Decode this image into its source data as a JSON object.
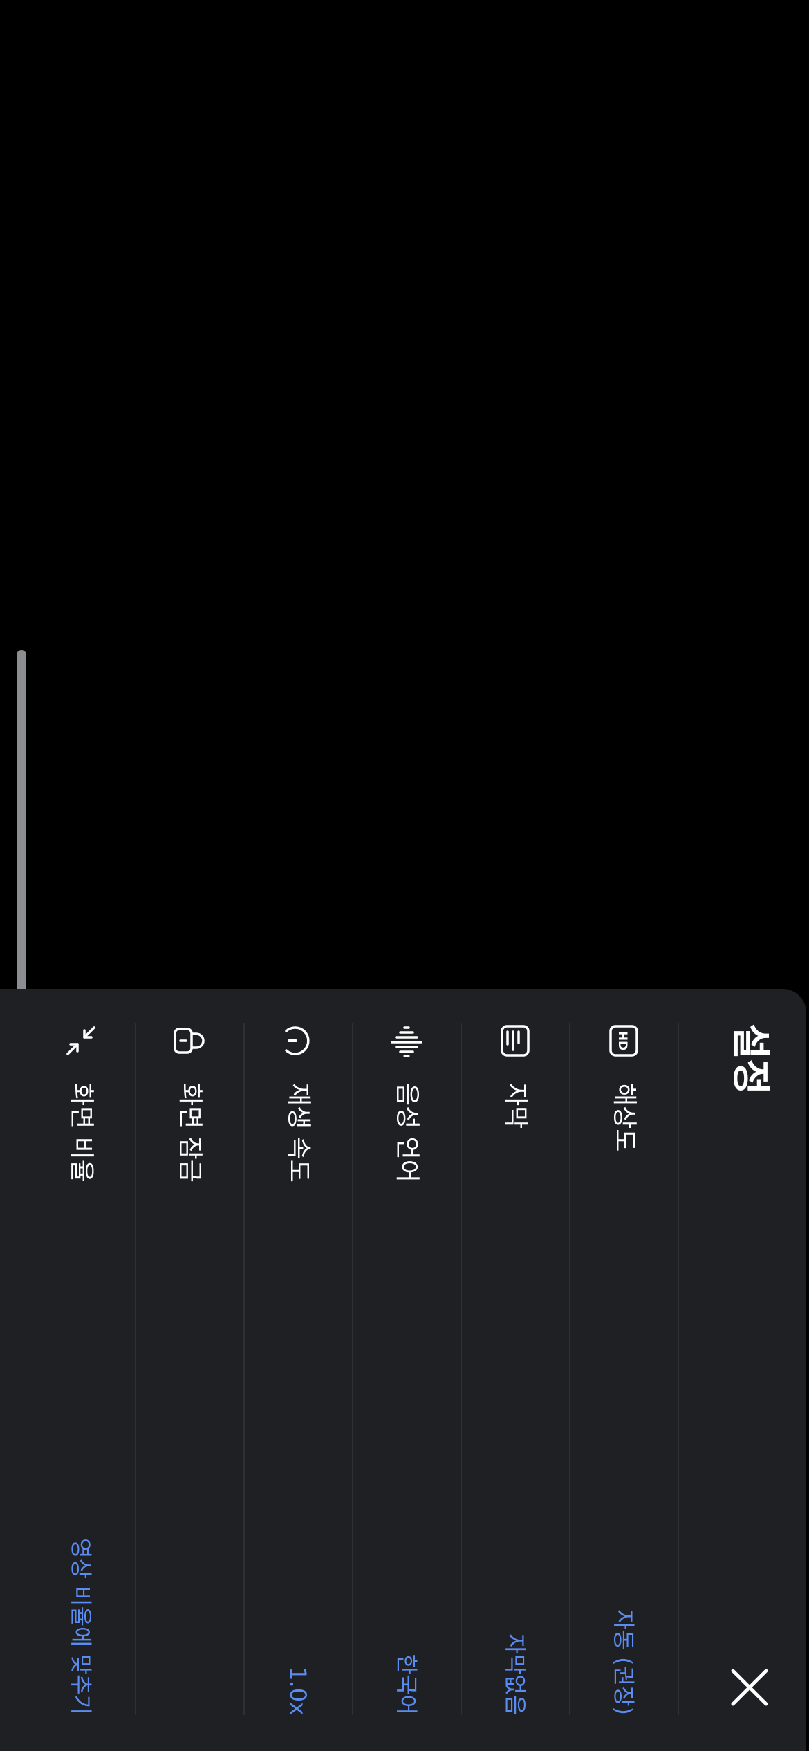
{
  "settings": {
    "title": "설정",
    "close_icon": "close-icon",
    "items": [
      {
        "icon": "hd-icon",
        "label": "해상도",
        "value": "자동 (권장)"
      },
      {
        "icon": "subtitles-icon",
        "label": "자막",
        "value": "자막없음"
      },
      {
        "icon": "audio-waveform-icon",
        "label": "음성 언어",
        "value": "한국어"
      },
      {
        "icon": "speed-gauge-icon",
        "label": "재생 속도",
        "value": "1.0x"
      },
      {
        "icon": "lock-icon",
        "label": "화면 잠금",
        "value": ""
      },
      {
        "icon": "shrink-arrows-icon",
        "label": "화면 비율",
        "value": "영상 비율에 맞추기"
      }
    ]
  },
  "colors": {
    "sheet_background": "#1e2024",
    "accent": "#5b8cf2",
    "text": "#ffffff",
    "divider": "#2d3036"
  }
}
